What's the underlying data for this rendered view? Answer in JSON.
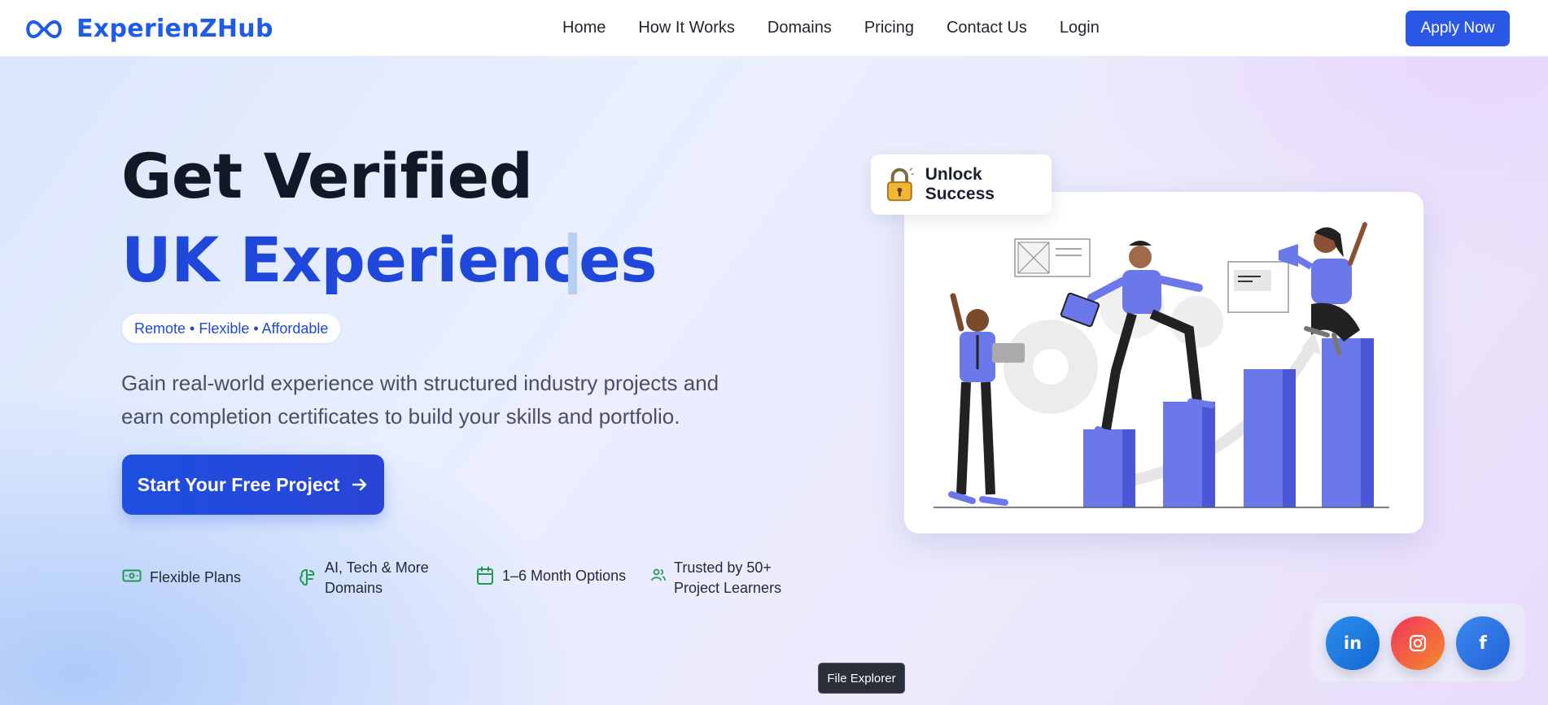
{
  "brand": {
    "name": "ExperienZHub"
  },
  "nav": {
    "links": [
      "Home",
      "How It Works",
      "Domains",
      "Pricing",
      "Contact Us",
      "Login"
    ],
    "apply_label": "Apply Now"
  },
  "hero": {
    "title_line1": "Get Verified",
    "title_line2": "UK Experiences",
    "pill": "Remote • Flexible • Affordable",
    "lead": "Gain real-world experience with structured industry projects and earn completion certificates to build your skills and portfolio.",
    "cta_label": "Start Your Free Project"
  },
  "features": [
    {
      "icon": "money-icon",
      "line1": "Flexible Plans",
      "line2": ""
    },
    {
      "icon": "brain-icon",
      "line1": "AI, Tech & More",
      "line2": "Domains"
    },
    {
      "icon": "calendar-icon",
      "line1": "1–6 Month Options",
      "line2": ""
    },
    {
      "icon": "users-icon",
      "line1": "Trusted by 50+",
      "line2": "Project Learners"
    }
  ],
  "illustration": {
    "badge_text": "Unlock Success",
    "badge_icon": "padlock-icon"
  },
  "social": {
    "items": [
      {
        "name": "linkedin-icon",
        "color": "#1f7ae0"
      },
      {
        "name": "instagram-icon",
        "color": "#ec3a6a"
      },
      {
        "name": "facebook-icon",
        "color": "#2f73e6"
      }
    ]
  },
  "tooltip": "File Explorer",
  "colors": {
    "brand": "#1e5be8",
    "accent": "#1f47d9",
    "feature_icon": "#1f9a4f"
  }
}
